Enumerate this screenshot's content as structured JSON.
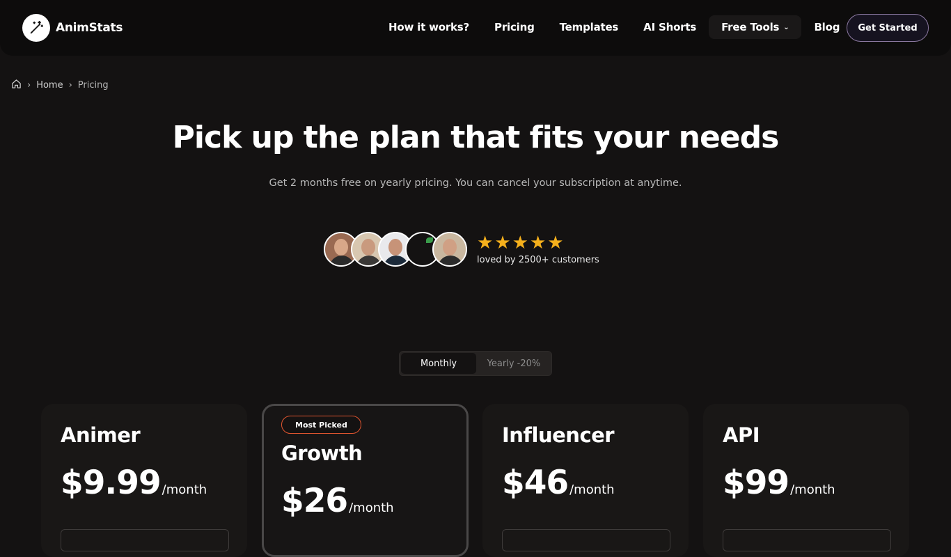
{
  "header": {
    "brand": "AnimStats",
    "nav": [
      {
        "label": "How it works?"
      },
      {
        "label": "Pricing"
      },
      {
        "label": "Templates"
      },
      {
        "label": "AI Shorts"
      },
      {
        "label": "Free Tools"
      },
      {
        "label": "Blog"
      }
    ],
    "cta": "Get Started"
  },
  "breadcrumb": {
    "home": "Home",
    "current": "Pricing"
  },
  "hero": {
    "title": "Pick up the plan that fits your needs",
    "subtitle": "Get 2 months free on yearly pricing. You can cancel your subscription at anytime."
  },
  "social_proof": {
    "rating": 5,
    "text": "loved by 2500+ customers"
  },
  "billing_toggle": {
    "monthly": "Monthly",
    "yearly": "Yearly -20%",
    "selected": "Monthly"
  },
  "plans": [
    {
      "name": "Animer",
      "price": "$9.99",
      "period": "/month"
    },
    {
      "name": "Growth",
      "price": "$26",
      "period": "/month",
      "badge": "Most Picked"
    },
    {
      "name": "Influencer",
      "price": "$46",
      "period": "/month"
    },
    {
      "name": "API",
      "price": "$99",
      "period": "/month"
    }
  ],
  "colors": {
    "background": "#141212",
    "star": "#f5b01c",
    "badge_border": "#e2552f",
    "cta_border": "#8d7aa3"
  }
}
